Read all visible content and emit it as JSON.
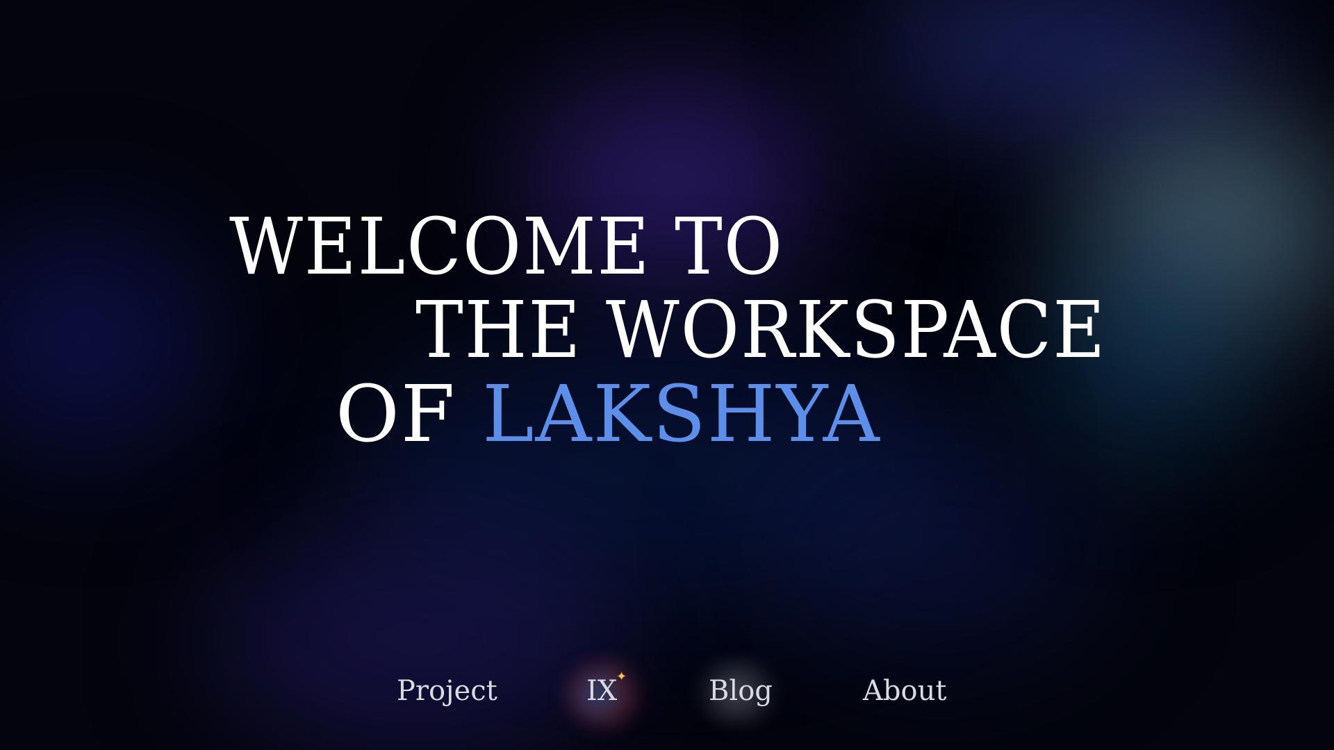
{
  "headline": {
    "line1": "WELCOME TO",
    "line2": "THE WORKSPACE",
    "line3_prefix": "OF ",
    "line3_name": "LAKSHYA"
  },
  "nav": {
    "items": [
      {
        "label": "Project"
      },
      {
        "label": "IX"
      },
      {
        "label": "Blog"
      },
      {
        "label": "About"
      }
    ],
    "ix_badge_icon": "sparkle-icon"
  },
  "colors": {
    "background": "#03040c",
    "headline_text": "#ffffff",
    "accent_name": "#5d8fea",
    "nav_text": "#d9dbe3",
    "sparkle": "#f2c84b"
  }
}
